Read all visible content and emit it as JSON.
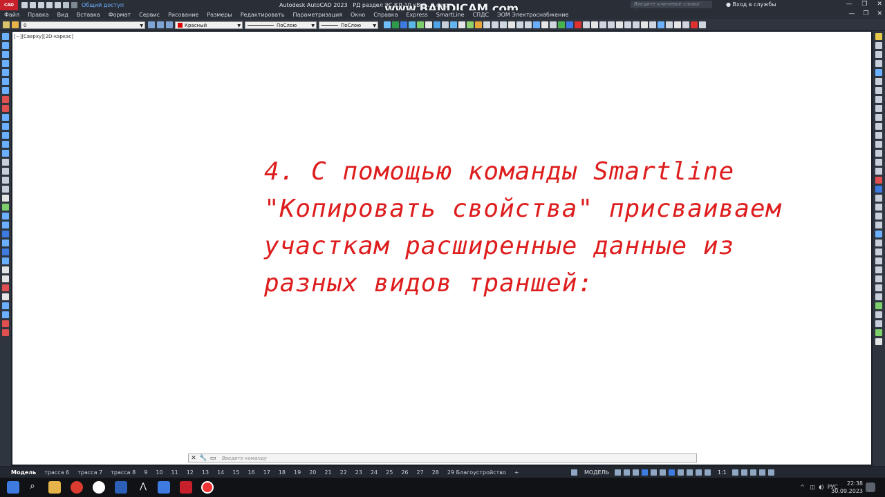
{
  "app": {
    "badge": "CAD",
    "share_label": "Общий доступ",
    "title": "Autodesk AutoCAD 2023",
    "filename": "РД раздел ЭС КЛ-10 кВ С...9.dwg",
    "search_placeholder": "Введите ключевое слово/фразу",
    "login": "Вход в службы",
    "watermark": "www.BANDICAM.com"
  },
  "menu": [
    "Файл",
    "Правка",
    "Вид",
    "Вставка",
    "Формат",
    "Сервис",
    "Рисование",
    "Размеры",
    "Редактировать",
    "Параметризация",
    "Окно",
    "Справка",
    "Express",
    "SmartLine",
    "СПДС",
    "ЭОМ Электроснабжение"
  ],
  "toolbar": {
    "layer_value": "0",
    "color_value": "Красный",
    "linetype_value": "ПоСлою",
    "lineweight_value": "ПоСлою"
  },
  "viewport": {
    "label": "[−][Сверху][2D-каркас]",
    "message_lines": [
      "4. С помощью команды Smartline",
      "\"Копировать свойства\" присваиваем",
      "участкам расширенные данные из",
      "разных видов траншей:"
    ],
    "message_color": "#de1e1e"
  },
  "command_line": {
    "placeholder": "Введите команду"
  },
  "layout_tabs": [
    "Модель",
    "трасса 6",
    "трасса 7",
    "трасса 8",
    "9",
    "10",
    "11",
    "12",
    "13",
    "14",
    "15",
    "16",
    "17",
    "18",
    "19",
    "20",
    "21",
    "22",
    "23",
    "24",
    "25",
    "26",
    "27",
    "28",
    "29 Благоустройство"
  ],
  "statusbar": {
    "mode": "МОДЕЛЬ",
    "scale": "1:1"
  },
  "taskbar": {
    "language": "РУС",
    "time": "22:38",
    "date": "30.09.2023"
  },
  "colors": {
    "accent": "#c8202b",
    "canvas": "#ffffff",
    "chrome": "#2a2f37"
  }
}
